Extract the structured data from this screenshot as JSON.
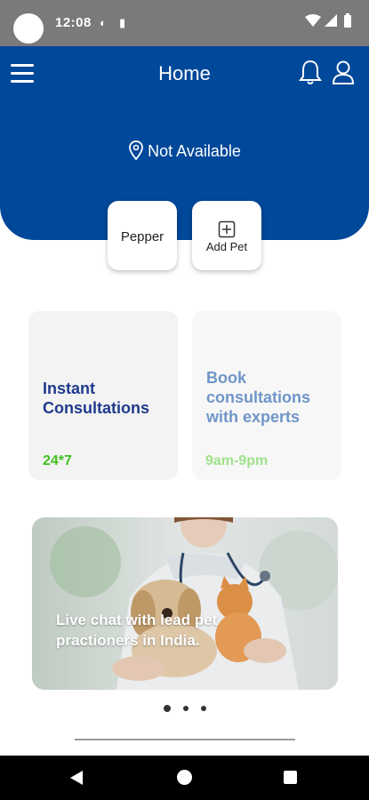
{
  "status_bar": {
    "time": "12:08"
  },
  "header": {
    "title": "Home",
    "location": "Not Available",
    "background_color": "#00489a"
  },
  "pets": {
    "items": [
      {
        "name": "Pepper"
      }
    ],
    "add_label": "Add Pet"
  },
  "consultations": [
    {
      "title": "Instant Consultations",
      "hours": "24*7"
    },
    {
      "title": "Book consultations with experts",
      "hours": "9am-9pm"
    }
  ],
  "banner": {
    "text": "Live chat with lead pet practioners in India.",
    "slide_count": 3,
    "active_slide": 1
  },
  "icons": {
    "menu": "hamburger-icon",
    "notifications": "bell-icon",
    "profile": "user-icon",
    "location": "location-pin-icon",
    "add": "plus-square-icon"
  }
}
